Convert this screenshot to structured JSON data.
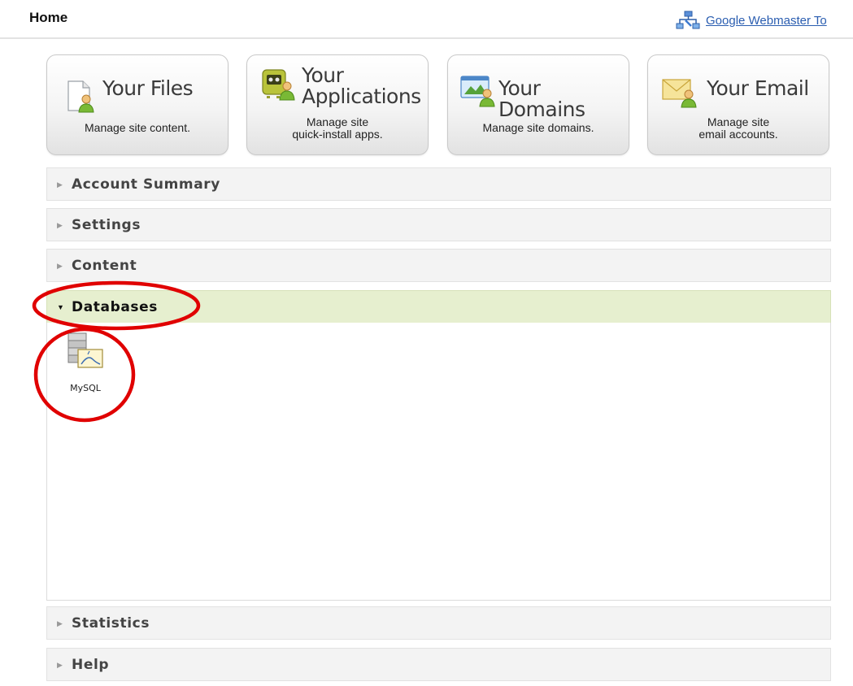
{
  "header": {
    "title": "Home",
    "webmaster_link": "Google Webmaster To",
    "webmaster_icon": "sitemap-icon"
  },
  "tiles": [
    {
      "title": "Your Files",
      "description": [
        "Manage site content."
      ],
      "icon": "files-icon"
    },
    {
      "title": [
        "Your",
        "Applications"
      ],
      "description": [
        "Manage site",
        "quick-install apps."
      ],
      "icon": "applications-icon"
    },
    {
      "title": "Your Domains",
      "description": [
        "Manage site domains."
      ],
      "icon": "domains-icon"
    },
    {
      "title": "Your Email",
      "description": [
        "Manage site",
        "email accounts."
      ],
      "icon": "email-icon"
    }
  ],
  "sections": [
    {
      "label": "Account Summary",
      "expanded": false
    },
    {
      "label": "Settings",
      "expanded": false
    },
    {
      "label": "Content",
      "expanded": false
    },
    {
      "label": "Databases",
      "expanded": true,
      "items": [
        {
          "label": "MySQL",
          "icon": "database-icon"
        }
      ]
    },
    {
      "label": "Statistics",
      "expanded": false
    },
    {
      "label": "Help",
      "expanded": false
    }
  ],
  "colors": {
    "link": "#2a5db0",
    "expanded_section_bg": "#e6efcf",
    "annotation": "#e00000"
  }
}
